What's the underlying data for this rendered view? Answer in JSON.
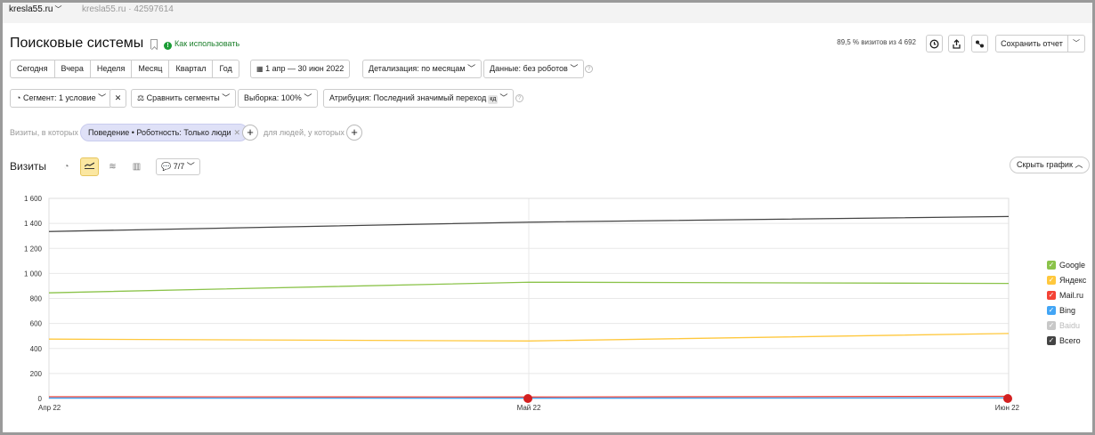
{
  "topbar": {
    "site": "kresla55.ru",
    "counter": "kresla55.ru · 42597614"
  },
  "header": {
    "title": "Поисковые системы",
    "howto": "Как использовать",
    "visits_pct": "89,5 % визитов из 4 692",
    "save_label": "Сохранить отчет"
  },
  "toolbar": {
    "periods": [
      "Сегодня",
      "Вчера",
      "Неделя",
      "Месяц",
      "Квартал",
      "Год"
    ],
    "date_range": "1 апр — 30 июн 2022",
    "detail": "Детализация: по месяцам",
    "data": "Данные: без роботов",
    "segment": "Сегмент: 1 условие",
    "compare": "Сравнить сегменты",
    "sample": "Выборка: 100%",
    "attribution": "Атрибуция: Последний значимый переход",
    "attribution_kbd": "кд"
  },
  "filters": {
    "visits_where": "Визиты, в которых",
    "chip": "Поведение • Роботность: Только люди",
    "people_where": "для людей, у которых"
  },
  "chart_section": {
    "title": "Визиты",
    "series_counter": "7/7",
    "hide_label": "Скрыть график"
  },
  "chart_data": {
    "type": "line",
    "x": [
      "Апр 22",
      "Май 22",
      "Июн 22"
    ],
    "ylim": [
      0,
      1600
    ],
    "yticks": [
      "0",
      "200",
      "400",
      "600",
      "800",
      "1 000",
      "1 200",
      "1 400",
      "1 600"
    ],
    "ytick_values": [
      0,
      200,
      400,
      600,
      800,
      1000,
      1200,
      1400,
      1600
    ],
    "series": [
      {
        "name": "Google",
        "color": "#8bc34a",
        "values": [
          845,
          930,
          920
        ],
        "enabled": true
      },
      {
        "name": "Яндекс",
        "color": "#ffc83d",
        "values": [
          475,
          460,
          520
        ],
        "enabled": true
      },
      {
        "name": "Mail.ru",
        "color": "#f44336",
        "values": [
          14,
          12,
          18
        ],
        "enabled": true
      },
      {
        "name": "Bing",
        "color": "#42a5f5",
        "values": [
          4,
          3,
          6
        ],
        "enabled": true
      },
      {
        "name": "Baidu",
        "color": "#c8c8c8",
        "values": [
          0,
          0,
          0
        ],
        "enabled": false
      },
      {
        "name": "Всего",
        "color": "#444444",
        "values": [
          1335,
          1410,
          1455
        ],
        "enabled": true
      }
    ]
  }
}
